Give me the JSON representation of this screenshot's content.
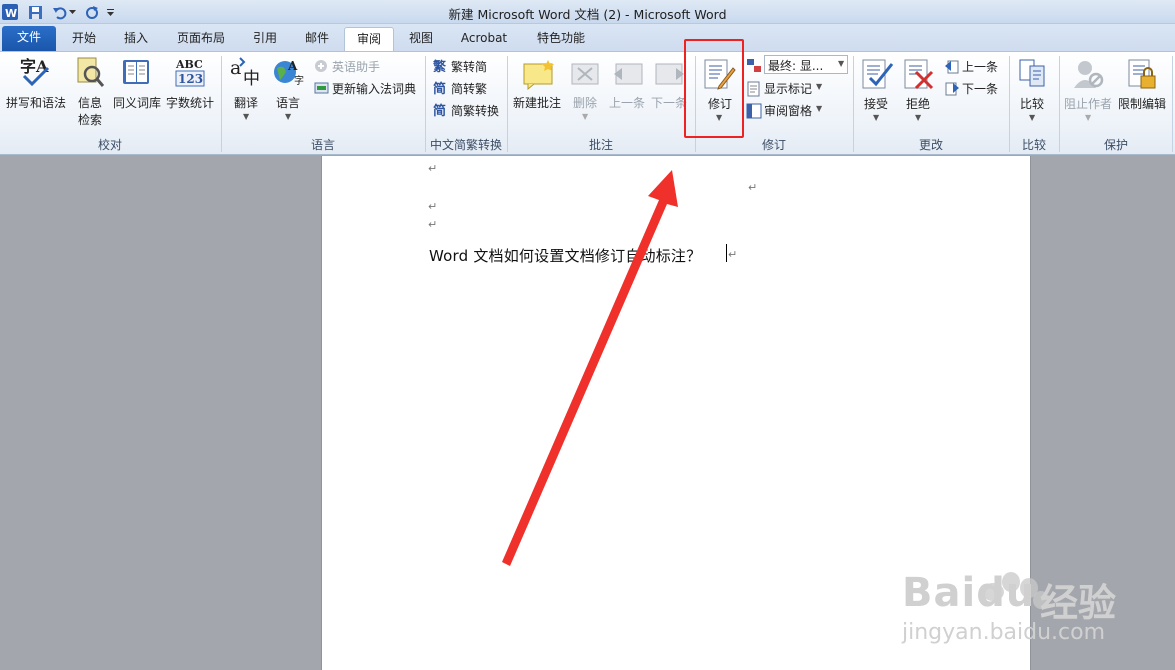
{
  "window": {
    "title": "新建 Microsoft Word 文档 (2)  -  Microsoft Word"
  },
  "tabs": [
    "文件",
    "开始",
    "插入",
    "页面布局",
    "引用",
    "邮件",
    "审阅",
    "视图",
    "Acrobat",
    "特色功能"
  ],
  "ribbon": {
    "proofing": {
      "spelling": "拼写和语法",
      "research_1": "信息",
      "research_2": "检索",
      "thesaurus": "同义词库",
      "word_count": "字数统计",
      "group": "校对"
    },
    "language": {
      "translate": "翻译",
      "language": "语言",
      "english_assistant": "英语助手",
      "update_ime": "更新输入法词典",
      "group": "语言"
    },
    "chinese": {
      "trad_to_simp": "繁转简",
      "simp_to_trad": "简转繁",
      "convert": "简繁转换",
      "group": "中文简繁转换"
    },
    "comments": {
      "new": "新建批注",
      "delete": "删除",
      "previous": "上一条",
      "next": "下一条",
      "group": "批注"
    },
    "tracking": {
      "track_changes": "修订",
      "display_for_review": "最终: 显...",
      "show_markup": "显示标记",
      "reviewing_pane": "审阅窗格",
      "group": "修订"
    },
    "changes": {
      "accept": "接受",
      "reject": "拒绝",
      "previous": "上一条",
      "next": "下一条",
      "group": "更改"
    },
    "compare": {
      "compare": "比较",
      "group": "比较"
    },
    "protect": {
      "block_authors": "阻止作者",
      "restrict_editing": "限制编辑",
      "group": "保护"
    }
  },
  "document": {
    "para_mark": "↵",
    "body_text": "Word 文档如何设置文档修订自动标注？"
  },
  "watermark": {
    "brand": "Baidu",
    "brand_cn": "经验",
    "url": "jingyan.baidu.com"
  },
  "colors": {
    "accent": "#2b6fc9",
    "highlight_box": "#ee2222",
    "arrow": "#f0302a"
  }
}
